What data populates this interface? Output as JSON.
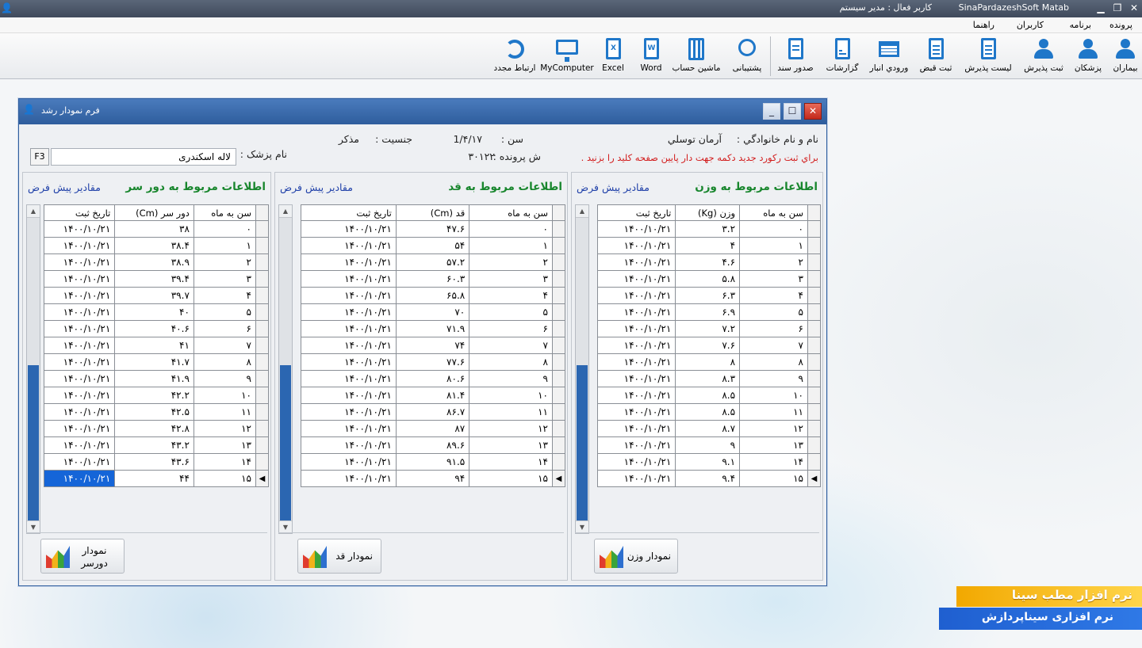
{
  "titlebar": {
    "app_name": "SinaPardazeshSoft Matab",
    "user": "کاربر فعال : مدیر سیستم"
  },
  "menu": [
    "پرونده",
    "برنامه",
    "کاربران",
    "راهنما"
  ],
  "toolbar": [
    {
      "label": "بیماران",
      "icon": "person-icon"
    },
    {
      "label": "پزشکان",
      "icon": "doctor-icon"
    },
    {
      "label": "ثبت پذیرش",
      "icon": "person-clock-icon"
    },
    {
      "label": "لیست پذیرش",
      "icon": "clipboard-icon"
    },
    {
      "label": "ثبت قبض",
      "icon": "receipt-icon"
    },
    {
      "label": "ورودي انبار",
      "icon": "warehouse-icon"
    },
    {
      "label": "گزارشات",
      "icon": "report-icon"
    },
    {
      "label": "صدور سند",
      "icon": "document-export-icon"
    },
    {
      "label": "پشتیبانی",
      "icon": "headset-icon"
    },
    {
      "label": "ماشین حساب",
      "icon": "calculator-icon"
    },
    {
      "label": "Word",
      "icon": "word-icon"
    },
    {
      "label": "Excel",
      "icon": "excel-icon"
    },
    {
      "label": "MyComputer",
      "icon": "monitor-icon"
    },
    {
      "label": "ارتباط مجدد",
      "icon": "refresh-icon"
    }
  ],
  "form": {
    "title": "فرم نمودار رشد",
    "name_label": "نام و نام خانوادگي :",
    "name_value": "آرمان توسلي",
    "age_label": "سن :",
    "age_value": "1/۴/۱۷",
    "gender_label": "جنسیت :",
    "gender_value": "مذکر",
    "hint": "براي ثبت ركورد جديد دكمه جهت دار پايين صفحه كليد را بزنيد .",
    "file_label": "ش پرونده :",
    "file_value": "۳۰۱۲۲",
    "doctor_label": "نام پزشک :",
    "doctor_value": "لاله اسکندری",
    "f3": "F3",
    "default_values": "مقادير پيش فرض"
  },
  "panels": {
    "weight": {
      "title": "اطلاعات مربوط به وزن",
      "col_age": "سن به ماه",
      "col_value": "وزن (Kg)",
      "col_date": "تاریخ ثبت",
      "chart_button": "نمودار وزن",
      "rows": [
        [
          "۰",
          "۳.۲",
          "۱۴۰۰/۱۰/۲۱"
        ],
        [
          "۱",
          "۴",
          "۱۴۰۰/۱۰/۲۱"
        ],
        [
          "۲",
          "۴.۶",
          "۱۴۰۰/۱۰/۲۱"
        ],
        [
          "۳",
          "۵.۸",
          "۱۴۰۰/۱۰/۲۱"
        ],
        [
          "۴",
          "۶.۳",
          "۱۴۰۰/۱۰/۲۱"
        ],
        [
          "۵",
          "۶.۹",
          "۱۴۰۰/۱۰/۲۱"
        ],
        [
          "۶",
          "۷.۲",
          "۱۴۰۰/۱۰/۲۱"
        ],
        [
          "۷",
          "۷.۶",
          "۱۴۰۰/۱۰/۲۱"
        ],
        [
          "۸",
          "۸",
          "۱۴۰۰/۱۰/۲۱"
        ],
        [
          "۹",
          "۸.۳",
          "۱۴۰۰/۱۰/۲۱"
        ],
        [
          "۱۰",
          "۸.۵",
          "۱۴۰۰/۱۰/۲۱"
        ],
        [
          "۱۱",
          "۸.۵",
          "۱۴۰۰/۱۰/۲۱"
        ],
        [
          "۱۲",
          "۸.۷",
          "۱۴۰۰/۱۰/۲۱"
        ],
        [
          "۱۳",
          "۹",
          "۱۴۰۰/۱۰/۲۱"
        ],
        [
          "۱۴",
          "۹.۱",
          "۱۴۰۰/۱۰/۲۱"
        ],
        [
          "۱۵",
          "۹.۴",
          "۱۴۰۰/۱۰/۲۱"
        ]
      ]
    },
    "height": {
      "title": "اطلاعات مربوط به قد",
      "col_age": "سن به ماه",
      "col_value": "قد (Cm)",
      "col_date": "تاریخ ثبت",
      "chart_button": "نمودار قد",
      "rows": [
        [
          "۰",
          "۴۷.۶",
          "۱۴۰۰/۱۰/۲۱"
        ],
        [
          "۱",
          "۵۴",
          "۱۴۰۰/۱۰/۲۱"
        ],
        [
          "۲",
          "۵۷.۲",
          "۱۴۰۰/۱۰/۲۱"
        ],
        [
          "۳",
          "۶۰.۳",
          "۱۴۰۰/۱۰/۲۱"
        ],
        [
          "۴",
          "۶۵.۸",
          "۱۴۰۰/۱۰/۲۱"
        ],
        [
          "۵",
          "۷۰",
          "۱۴۰۰/۱۰/۲۱"
        ],
        [
          "۶",
          "۷۱.۹",
          "۱۴۰۰/۱۰/۲۱"
        ],
        [
          "۷",
          "۷۴",
          "۱۴۰۰/۱۰/۲۱"
        ],
        [
          "۸",
          "۷۷.۶",
          "۱۴۰۰/۱۰/۲۱"
        ],
        [
          "۹",
          "۸۰.۶",
          "۱۴۰۰/۱۰/۲۱"
        ],
        [
          "۱۰",
          "۸۱.۴",
          "۱۴۰۰/۱۰/۲۱"
        ],
        [
          "۱۱",
          "۸۶.۷",
          "۱۴۰۰/۱۰/۲۱"
        ],
        [
          "۱۲",
          "۸۷",
          "۱۴۰۰/۱۰/۲۱"
        ],
        [
          "۱۳",
          "۸۹.۶",
          "۱۴۰۰/۱۰/۲۱"
        ],
        [
          "۱۴",
          "۹۱.۵",
          "۱۴۰۰/۱۰/۲۱"
        ],
        [
          "۱۵",
          "۹۴",
          "۱۴۰۰/۱۰/۲۱"
        ]
      ]
    },
    "head": {
      "title": "اطلاعات مربوط به دور سر",
      "col_age": "سن به ماه",
      "col_value": "دور سر (Cm)",
      "col_date": "تاریخ ثبت",
      "chart_button": "نمودار دورسر",
      "rows": [
        [
          "۰",
          "۳۸",
          "۱۴۰۰/۱۰/۲۱"
        ],
        [
          "۱",
          "۳۸.۴",
          "۱۴۰۰/۱۰/۲۱"
        ],
        [
          "۲",
          "۳۸.۹",
          "۱۴۰۰/۱۰/۲۱"
        ],
        [
          "۳",
          "۳۹.۴",
          "۱۴۰۰/۱۰/۲۱"
        ],
        [
          "۴",
          "۳۹.۷",
          "۱۴۰۰/۱۰/۲۱"
        ],
        [
          "۵",
          "۴۰",
          "۱۴۰۰/۱۰/۲۱"
        ],
        [
          "۶",
          "۴۰.۶",
          "۱۴۰۰/۱۰/۲۱"
        ],
        [
          "۷",
          "۴۱",
          "۱۴۰۰/۱۰/۲۱"
        ],
        [
          "۸",
          "۴۱.۷",
          "۱۴۰۰/۱۰/۲۱"
        ],
        [
          "۹",
          "۴۱.۹",
          "۱۴۰۰/۱۰/۲۱"
        ],
        [
          "۱۰",
          "۴۲.۲",
          "۱۴۰۰/۱۰/۲۱"
        ],
        [
          "۱۱",
          "۴۲.۵",
          "۱۴۰۰/۱۰/۲۱"
        ],
        [
          "۱۲",
          "۴۲.۸",
          "۱۴۰۰/۱۰/۲۱"
        ],
        [
          "۱۳",
          "۴۳.۲",
          "۱۴۰۰/۱۰/۲۱"
        ],
        [
          "۱۴",
          "۴۳.۶",
          "۱۴۰۰/۱۰/۲۱"
        ],
        [
          "۱۵",
          "۴۴",
          "۱۴۰۰/۱۰/۲۱"
        ]
      ]
    }
  },
  "banner": {
    "line1": "نرم افزار مطب سینا",
    "line2": "نرم افزاری سیناپردازش"
  },
  "colors": {
    "form_title": "#2e5d9d",
    "panel_title": "#18862d",
    "default_link": "#1e3fa8",
    "hint": "#d21c1c",
    "selected": "#1565d8"
  }
}
